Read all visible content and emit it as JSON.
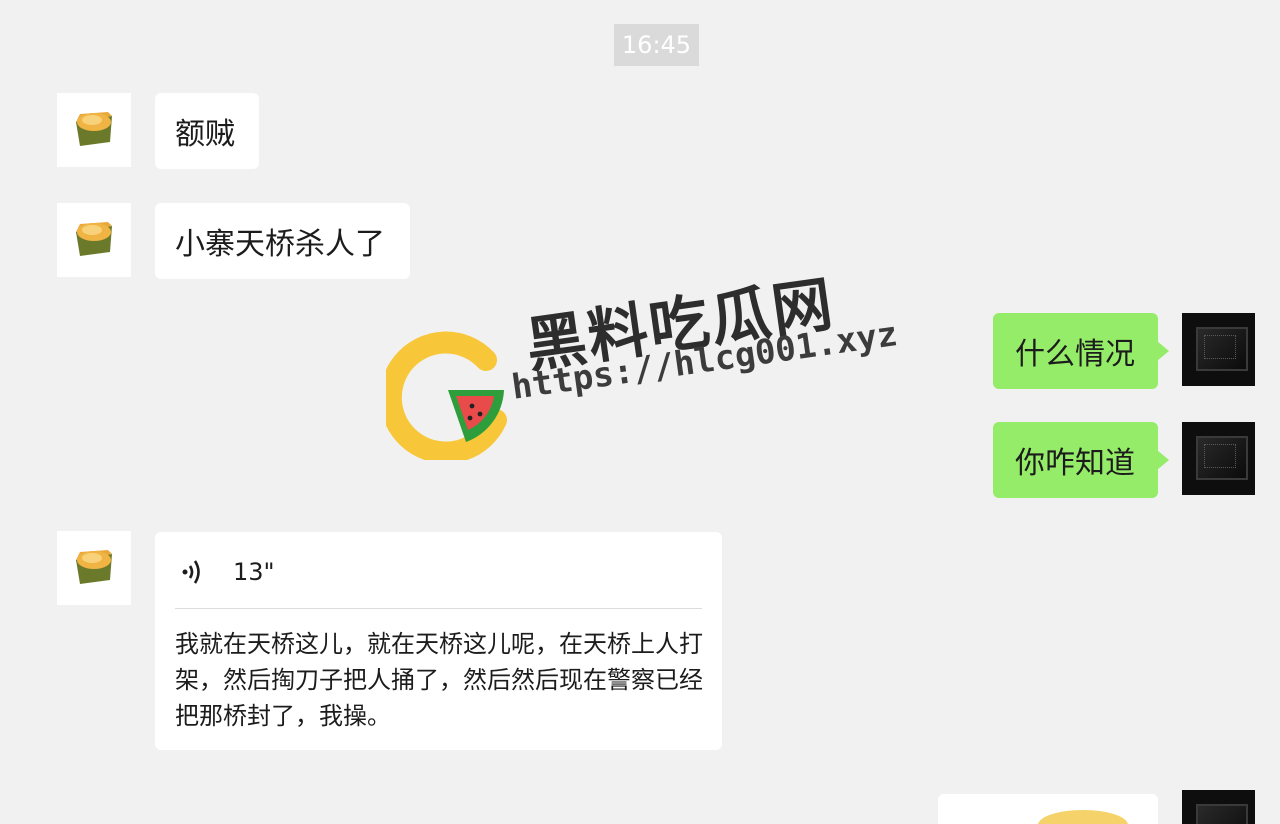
{
  "timestamp": "16:45",
  "messages": {
    "m1": {
      "text": "额贼"
    },
    "m2": {
      "text": "小寨天桥杀人了"
    },
    "m3": {
      "text": "什么情况"
    },
    "m4": {
      "text": "你咋知道"
    },
    "m5": {
      "duration": "13\"",
      "transcript": "我就在天桥这儿，就在天桥这儿呢，在天桥上人打架，然后掏刀子把人捅了，然后然后现在警察已经把那桥封了，我操。"
    }
  },
  "watermark": {
    "title": "黑料吃瓜网",
    "url": "https://hlcg001.xyz"
  },
  "colors": {
    "background": "#f1f1f1",
    "outgoing_bubble": "#95ec69",
    "incoming_bubble": "#ffffff",
    "timestamp_bg": "#dadada"
  },
  "icons": {
    "left_avatar": "cake-slice-icon",
    "right_avatar": "dark-photo-avatar",
    "voice": "voice-wave-icon",
    "logo": "watermelon-logo-icon"
  }
}
